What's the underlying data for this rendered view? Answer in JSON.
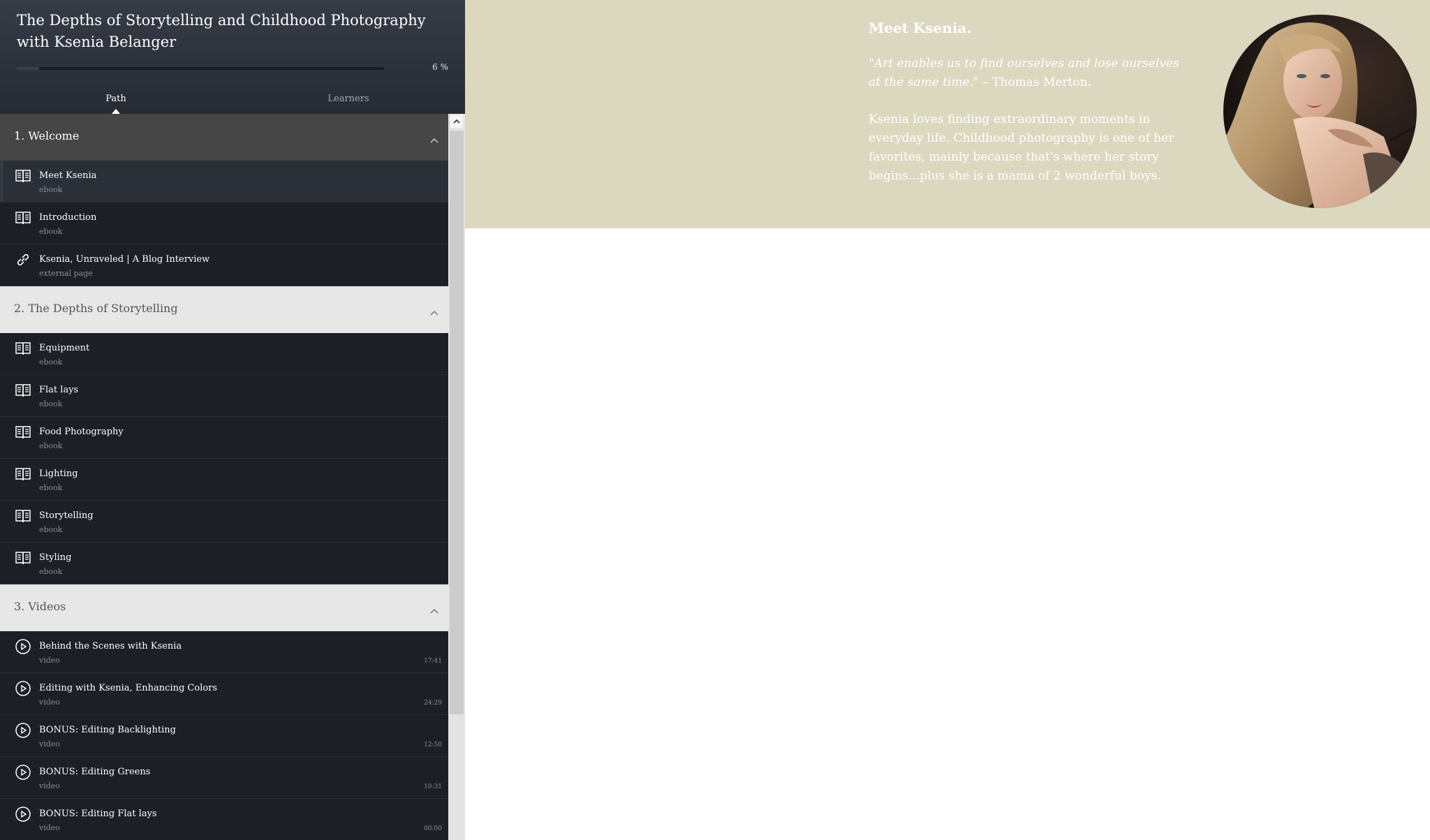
{
  "course": {
    "title": "The Depths of Storytelling and Childhood Photography with Ksenia Belanger",
    "progress_text": "6 %",
    "progress_fraction": 0.06
  },
  "tabs": [
    {
      "label": "Path",
      "active": true
    },
    {
      "label": "Learners",
      "active": false
    }
  ],
  "sections": [
    {
      "title": "1. Welcome",
      "style": "active",
      "items": [
        {
          "title": "Meet Ksenia",
          "type": "ebook",
          "icon": "book-icon",
          "selected": true
        },
        {
          "title": "Introduction",
          "type": "ebook",
          "icon": "book-icon"
        },
        {
          "title": "Ksenia, Unraveled | A Blog Interview",
          "type": "external page",
          "icon": "link-icon"
        }
      ]
    },
    {
      "title": "2. The Depths of Storytelling",
      "style": "light",
      "items": [
        {
          "title": "Equipment",
          "type": "ebook",
          "icon": "book-icon"
        },
        {
          "title": "Flat lays",
          "type": "ebook",
          "icon": "book-icon"
        },
        {
          "title": "Food Photography",
          "type": "ebook",
          "icon": "book-icon"
        },
        {
          "title": "Lighting",
          "type": "ebook",
          "icon": "book-icon"
        },
        {
          "title": "Storytelling",
          "type": "ebook",
          "icon": "book-icon"
        },
        {
          "title": "Styling",
          "type": "ebook",
          "icon": "book-icon"
        }
      ]
    },
    {
      "title": "3. Videos",
      "style": "light",
      "items": [
        {
          "title": "Behind the Scenes with Ksenia",
          "type": "video",
          "icon": "play-icon",
          "duration": "17:41"
        },
        {
          "title": "Editing with Ksenia, Enhancing Colors",
          "type": "video",
          "icon": "play-icon",
          "duration": "24:29"
        },
        {
          "title": "BONUS: Editing Backlighting",
          "type": "video",
          "icon": "play-icon",
          "duration": "12:50"
        },
        {
          "title": "BONUS: Editing Greens",
          "type": "video",
          "icon": "play-icon",
          "duration": "10:31"
        },
        {
          "title": "BONUS: Editing Flat lays",
          "type": "video",
          "icon": "play-icon",
          "duration": "00:00"
        }
      ]
    }
  ],
  "content": {
    "heading": "Meet Ksenia.",
    "quote_text": "\"Art enables us to find ourselves and lose ourselves at the same time.\"",
    "quote_author": " – Thomas Merton.",
    "bio": "Ksenia loves finding extraordinary moments in everyday life. Childhood photography is one of her favorites, mainly because that's where her story begins...plus she is a mama of 2 wonderful boys."
  },
  "colors": {
    "sidebar_bg": "#1c1f26",
    "banner_bg": "#dcd8c0",
    "section_active_bg": "#464646",
    "section_light_bg": "#e7e7e7"
  }
}
